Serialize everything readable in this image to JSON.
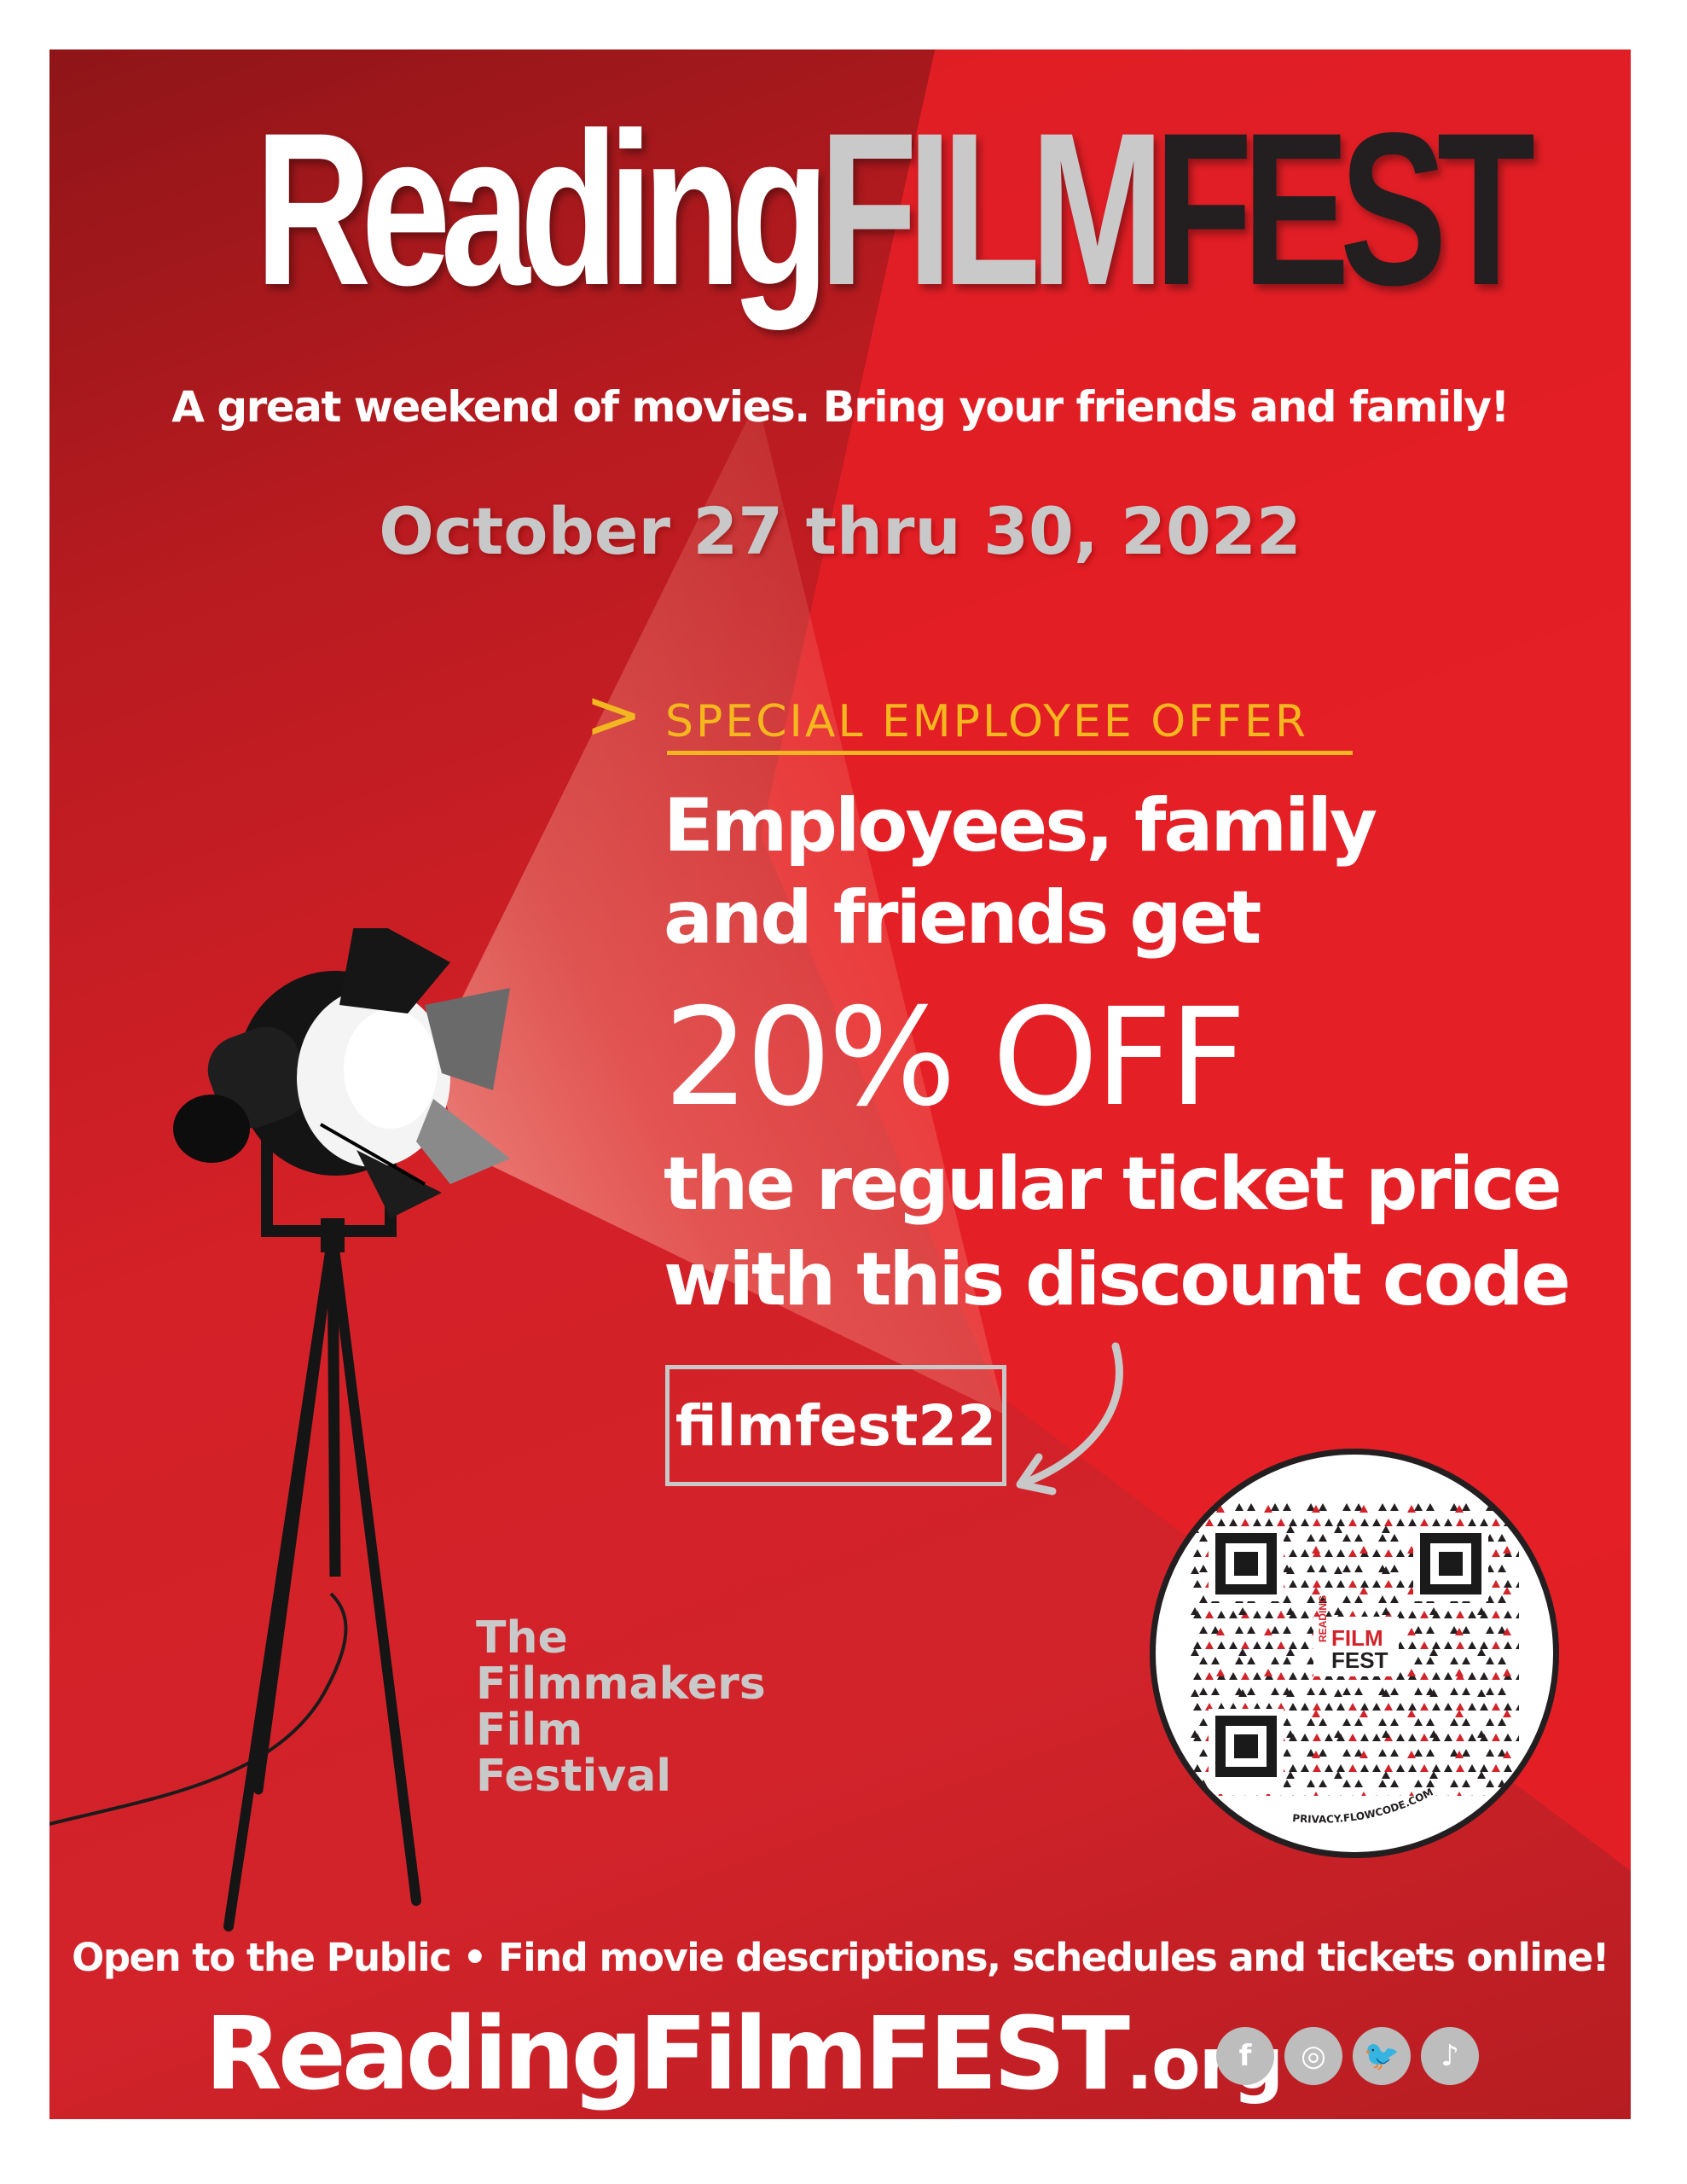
{
  "title": {
    "part1": "Reading",
    "part2": "FILM",
    "part3": "FEST"
  },
  "tagline": "A great weekend of movies.  Bring your friends and family!",
  "dates": "October 27 thru 30, 2022",
  "offer": {
    "chevron": ">",
    "label": "SPECIAL EMPLOYEE OFFER",
    "line1": "Employees, family",
    "line2": "and friends  get",
    "line3": "20% OFF",
    "line4": "the regular ticket price",
    "line5": "with this discount code",
    "code": "filmfest22"
  },
  "org": {
    "line1": "The",
    "line2": "Filmmakers",
    "line3": "Film",
    "line4": "Festival"
  },
  "qr": {
    "center_logo_top": "FILM",
    "center_logo_bottom": "FEST",
    "center_logo_side": "READING",
    "brand_label": "FLOWCODE",
    "privacy": "PRIVACY.FLOWCODE.COM"
  },
  "footer": {
    "public_line": "Open to the Public  •  Find movie descriptions, schedules and tickets online!",
    "website_main": "ReadingFilmFEST",
    "website_tld": ".org"
  },
  "social": [
    {
      "name": "facebook-icon",
      "glyph": "f"
    },
    {
      "name": "instagram-icon",
      "glyph": "◎"
    },
    {
      "name": "twitter-icon",
      "glyph": "🐦"
    },
    {
      "name": "tiktok-icon",
      "glyph": "♪"
    }
  ],
  "colors": {
    "background_red": "#d2232a",
    "dark_red": "#8f1518",
    "accent_yellow": "#f2b620",
    "light_gray": "#c9c9c9",
    "black": "#231f20"
  }
}
